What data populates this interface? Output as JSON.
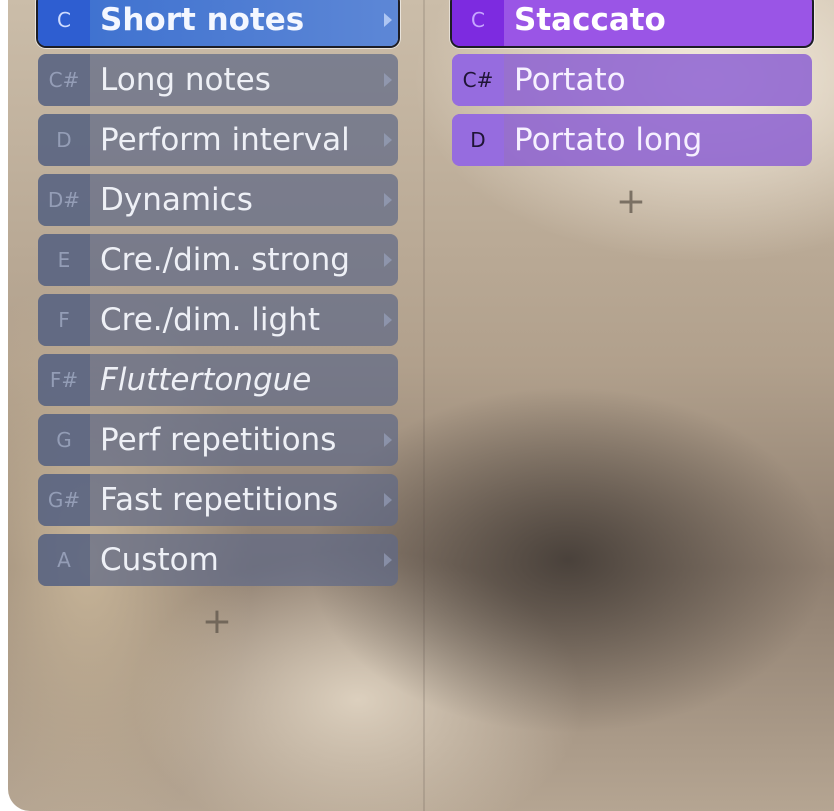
{
  "left_column": {
    "items": [
      {
        "key": "C",
        "label": "Short notes"
      },
      {
        "key": "C#",
        "label": "Long notes"
      },
      {
        "key": "D",
        "label": "Perform interval"
      },
      {
        "key": "D#",
        "label": "Dynamics"
      },
      {
        "key": "E",
        "label": "Cre./dim. strong"
      },
      {
        "key": "F",
        "label": "Cre./dim. light"
      },
      {
        "key": "F#",
        "label": "Fluttertongue"
      },
      {
        "key": "G",
        "label": "Perf repetitions"
      },
      {
        "key": "G#",
        "label": "Fast repetitions"
      },
      {
        "key": "A",
        "label": "Custom"
      }
    ],
    "add_label": "+"
  },
  "right_column": {
    "items": [
      {
        "key": "C",
        "label": "Staccato"
      },
      {
        "key": "C#",
        "label": "Portato"
      },
      {
        "key": "D",
        "label": "Portato long"
      }
    ],
    "add_label": "+"
  },
  "colors": {
    "selected_left": "#3b6fcf",
    "selected_right": "#9a55e6",
    "right_item": "#8d62d2",
    "left_item": "#5f6987"
  }
}
